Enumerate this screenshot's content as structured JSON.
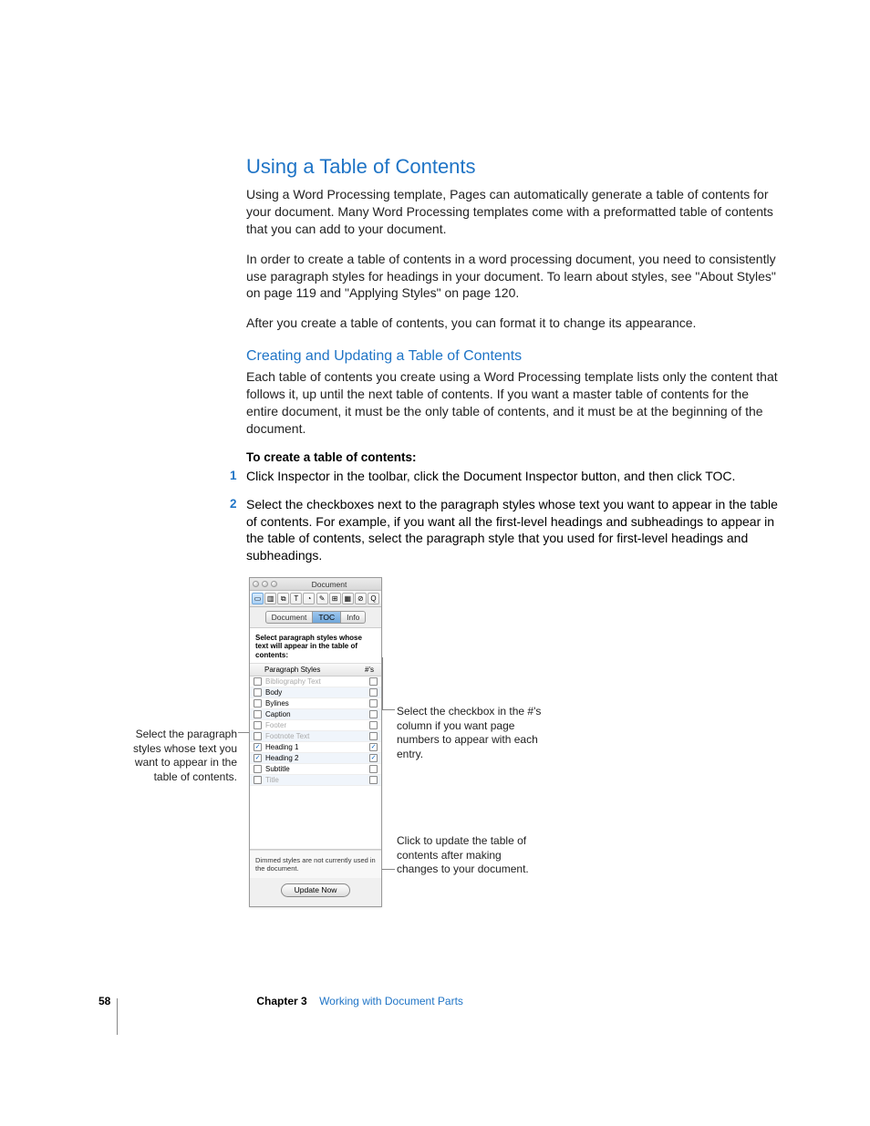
{
  "heading1": "Using a Table of Contents",
  "para1": " Using a Word Processing template, Pages can automatically generate a table of contents for your document. Many Word Processing templates come with a preformatted table of contents that you can add to your document.",
  "para2": "In order to create a table of contents in a word processing document, you need to consistently use paragraph styles for headings in your document. To learn about styles, see \"About Styles\" on page 119 and \"Applying Styles\" on page 120.",
  "para3": "After you create a table of contents, you can format it to change its appearance.",
  "heading2": "Creating and Updating a Table of Contents",
  "para4": "Each table of contents you create using a Word Processing template lists only the content that follows it, up until the next table of contents. If you want a master table of contents for the entire document, it must be the only table of contents, and it must be at the beginning of the document.",
  "steps_heading": "To create a table of contents:",
  "step1": "Click Inspector in the toolbar, click the Document Inspector button, and then click TOC.",
  "step2": "Select the checkboxes next to the paragraph styles whose text you want to appear in the table of contents. For example, if you want all the first-level headings and subheadings to appear in the table of contents, select the paragraph style that you used for first-level headings and subheadings.",
  "callout_left": "Select the paragraph styles whose text you want to appear in the table of contents.",
  "callout_right1": "Select the checkbox in the #'s column if you want page numbers to appear with each entry.",
  "callout_right2": "Click to update the table of contents after making changes to your document.",
  "inspector": {
    "title": "Document",
    "tabs": {
      "doc": "Document",
      "toc": "TOC",
      "info": "Info"
    },
    "instruction": "Select paragraph styles whose text will appear in the table of contents:",
    "col_styles": "Paragraph Styles",
    "col_nums": "#'s",
    "rows": [
      {
        "name": "Bibliography Text",
        "dimmed": true,
        "check1": false,
        "check2": false
      },
      {
        "name": "Body",
        "dimmed": false,
        "check1": false,
        "check2": false
      },
      {
        "name": "Bylines",
        "dimmed": false,
        "check1": false,
        "check2": false
      },
      {
        "name": "Caption",
        "dimmed": false,
        "check1": false,
        "check2": false
      },
      {
        "name": "Footer",
        "dimmed": true,
        "check1": false,
        "check2": false
      },
      {
        "name": "Footnote Text",
        "dimmed": true,
        "check1": false,
        "check2": false
      },
      {
        "name": "Heading 1",
        "dimmed": false,
        "check1": true,
        "check2": true
      },
      {
        "name": "Heading 2",
        "dimmed": false,
        "check1": true,
        "check2": true
      },
      {
        "name": "Subtitle",
        "dimmed": false,
        "check1": false,
        "check2": false
      },
      {
        "name": "Title",
        "dimmed": true,
        "check1": false,
        "check2": false
      }
    ],
    "dimnote": "Dimmed styles are not currently used in the document.",
    "update_btn": "Update Now"
  },
  "footer": {
    "page": "58",
    "chapter_label": "Chapter 3",
    "chapter_title": "Working with Document Parts"
  }
}
